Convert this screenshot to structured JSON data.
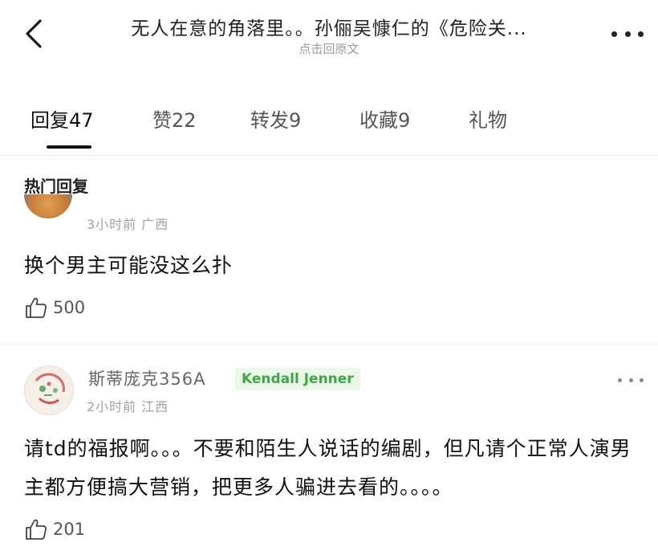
{
  "header": {
    "title": "无人在意的角落里。。孙俪吴慷仁的《危险关...",
    "subtitle": "点击回原文"
  },
  "tabs": [
    {
      "label": "回复",
      "count": "47"
    },
    {
      "label": "赞",
      "count": "22"
    },
    {
      "label": "转发",
      "count": "9"
    },
    {
      "label": "收藏",
      "count": "9"
    },
    {
      "label": "礼物",
      "count": ""
    }
  ],
  "section_title": "热门回复",
  "comments": [
    {
      "meta": "3小时前 广西",
      "text": "换个男主可能没这么扑",
      "likes": "500"
    },
    {
      "username": "斯蒂庞克356A",
      "badge": "Kendall Jenner",
      "meta": "2小时前 江西",
      "text": "请td的福报啊。。。不要和陌生人说话的编剧，但凡请个正常人演男主都方便搞大营销，把更多人骗进去看的。。。。",
      "likes": "201"
    }
  ],
  "icons": {
    "back": "chevron-left-icon",
    "more": "more-horizontal-icon",
    "like": "thumbs-up-icon"
  },
  "colors": {
    "badge_bg": "#edf7e8",
    "badge_text": "#3fa64a",
    "meta_text": "#a0a0a8"
  }
}
